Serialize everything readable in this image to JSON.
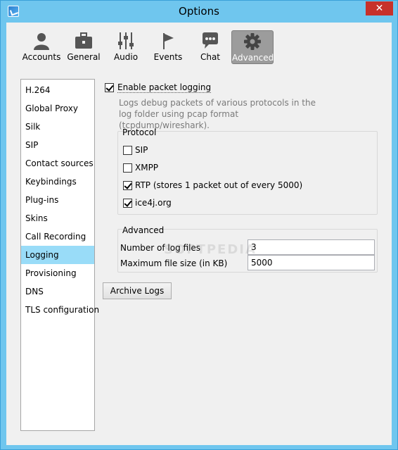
{
  "window": {
    "title": "Options",
    "close_glyph": "✕"
  },
  "toolbar": {
    "items": [
      {
        "label": "Accounts",
        "icon": "user-icon"
      },
      {
        "label": "General",
        "icon": "briefcase-icon"
      },
      {
        "label": "Audio",
        "icon": "sliders-icon"
      },
      {
        "label": "Events",
        "icon": "flag-icon"
      },
      {
        "label": "Chat",
        "icon": "chat-bubble-icon"
      },
      {
        "label": "Advanced",
        "icon": "gear-icon",
        "selected": true
      }
    ]
  },
  "sidebar": {
    "items": [
      {
        "label": "H.264"
      },
      {
        "label": "Global Proxy"
      },
      {
        "label": "Silk"
      },
      {
        "label": "SIP"
      },
      {
        "label": "Contact sources"
      },
      {
        "label": "Keybindings"
      },
      {
        "label": "Plug-ins"
      },
      {
        "label": "Skins"
      },
      {
        "label": "Call Recording"
      },
      {
        "label": "Logging",
        "selected": true
      },
      {
        "label": "Provisioning"
      },
      {
        "label": "DNS"
      },
      {
        "label": "TLS configuration"
      }
    ]
  },
  "logging": {
    "enable_label": "Enable packet logging",
    "enable_checked": true,
    "description_line1": "Logs debug packets of various protocols in the",
    "description_line2": "log folder using pcap format (tcpdump/wireshark).",
    "protocol_group": {
      "title": "Protocol",
      "options": [
        {
          "label": "SIP",
          "checked": false
        },
        {
          "label": "XMPP",
          "checked": false
        },
        {
          "label": "RTP (stores 1 packet out of every 5000)",
          "checked": true
        },
        {
          "label": "ice4j.org",
          "checked": true
        }
      ]
    },
    "advanced_group": {
      "title": "Advanced",
      "log_files_label": "Number of log files",
      "log_files_value": "3",
      "max_size_label": "Maximum file size (in KB)",
      "max_size_value": "5000"
    },
    "archive_button": "Archive Logs"
  },
  "watermark": "SOFTPEDIA",
  "colors": {
    "titlebar": "#6fc6ee",
    "selection": "#99dcf8",
    "close": "#c7312a"
  }
}
